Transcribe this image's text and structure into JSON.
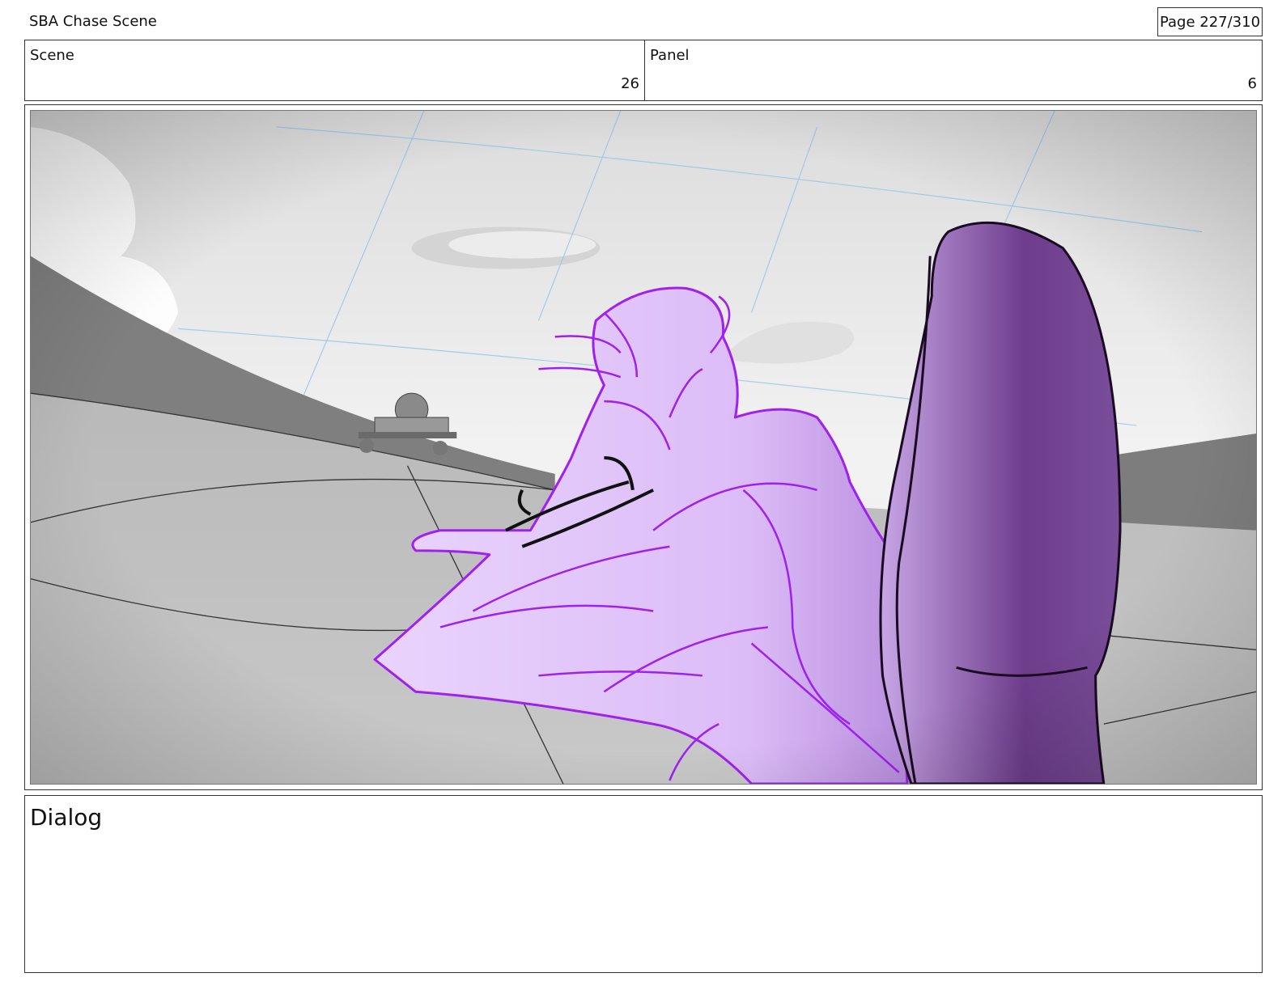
{
  "header": {
    "document_title": "SBA Chase Scene",
    "page_indicator": "Page 227/310"
  },
  "info": {
    "scene_label": "Scene",
    "scene_value": "26",
    "panel_label": "Panel",
    "panel_value": "6"
  },
  "dialog": {
    "label": "Dialog"
  },
  "colors": {
    "figure_outline": "#a020f0",
    "figure_fill": "#e3c6fb",
    "foreground_shape": "#6e3d8c",
    "grid_lines": "#8ec5ea"
  }
}
